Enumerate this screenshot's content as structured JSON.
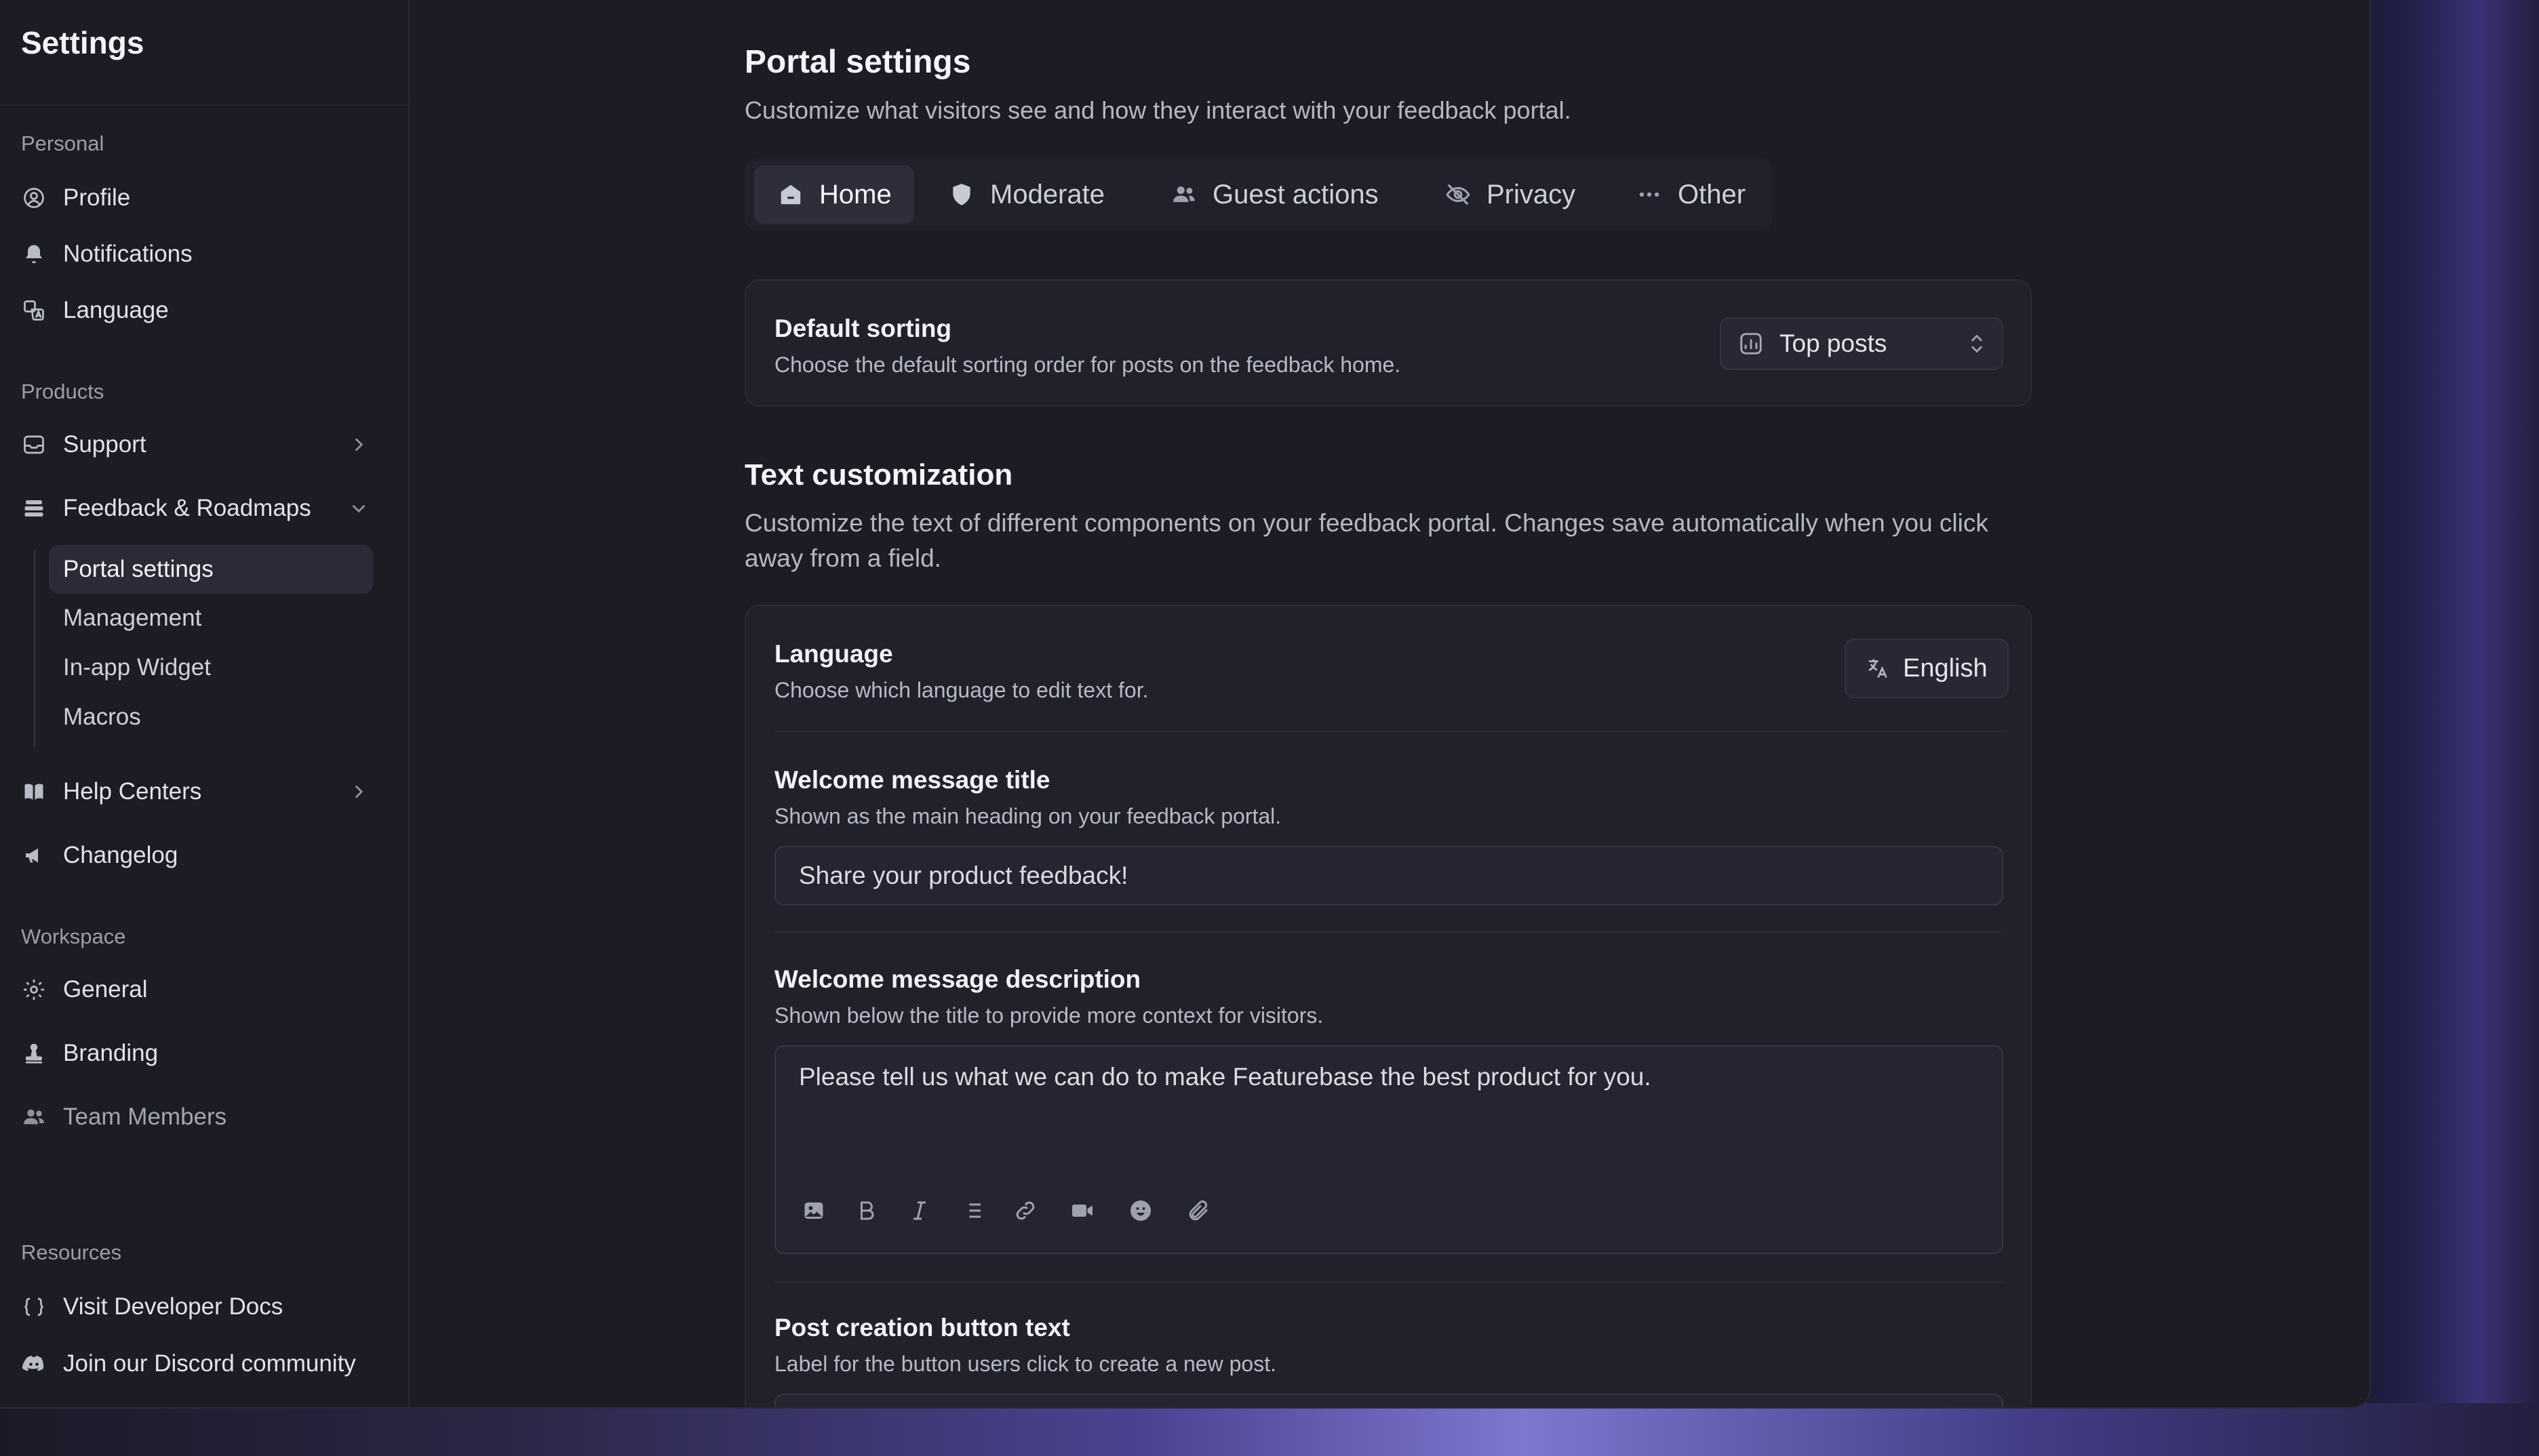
{
  "sidebar": {
    "title": "Settings",
    "sections": {
      "personal": "Personal",
      "products": "Products",
      "workspace": "Workspace",
      "resources": "Resources"
    },
    "personal_items": [
      "Profile",
      "Notifications",
      "Language"
    ],
    "product_items": {
      "support": "Support",
      "feedback": "Feedback & Roadmaps",
      "help_centers": "Help Centers",
      "changelog": "Changelog"
    },
    "feedback_subitems": [
      "Portal settings",
      "Management",
      "In-app Widget",
      "Macros"
    ],
    "workspace_items": [
      "General",
      "Branding",
      "Team Members"
    ],
    "resource_items": [
      "Visit Developer Docs",
      "Join our Discord community"
    ]
  },
  "main": {
    "title": "Portal settings",
    "subtitle": "Customize what visitors see and how they interact with your feedback portal.",
    "tabs": [
      {
        "label": "Home",
        "icon": "home-icon",
        "active": true
      },
      {
        "label": "Moderate",
        "icon": "shield-icon",
        "active": false
      },
      {
        "label": "Guest actions",
        "icon": "users-icon",
        "active": false
      },
      {
        "label": "Privacy",
        "icon": "eye-off-icon",
        "active": false
      },
      {
        "label": "Other",
        "icon": "more-icon",
        "active": false
      }
    ],
    "default_sorting": {
      "label": "Default sorting",
      "description": "Choose the default sorting order for posts on the feedback home.",
      "value": "Top posts"
    },
    "text_customization": {
      "title": "Text customization",
      "subtitle": "Customize the text of different components on your feedback portal. Changes save automatically when you click away from a field."
    },
    "language": {
      "label": "Language",
      "description": "Choose which language to edit text for.",
      "value": "English"
    },
    "welcome_title": {
      "label": "Welcome message title",
      "description": "Shown as the main heading on your feedback portal.",
      "value": "Share your product feedback!"
    },
    "welcome_description": {
      "label": "Welcome message description",
      "description": "Shown below the title to provide more context for visitors.",
      "value": "Please tell us what we can do to make Featurebase the best product for you.",
      "toolbar": [
        "image-icon",
        "bold-icon",
        "italic-icon",
        "list-icon",
        "link-icon",
        "video-icon",
        "emoji-icon",
        "attachment-icon"
      ]
    },
    "post_button": {
      "label": "Post creation button text",
      "description": "Label for the button users click to create a new post."
    }
  },
  "colors": {
    "background": "#1b1c24",
    "card": "#20212b",
    "accent_glow": "#7d77cf"
  }
}
